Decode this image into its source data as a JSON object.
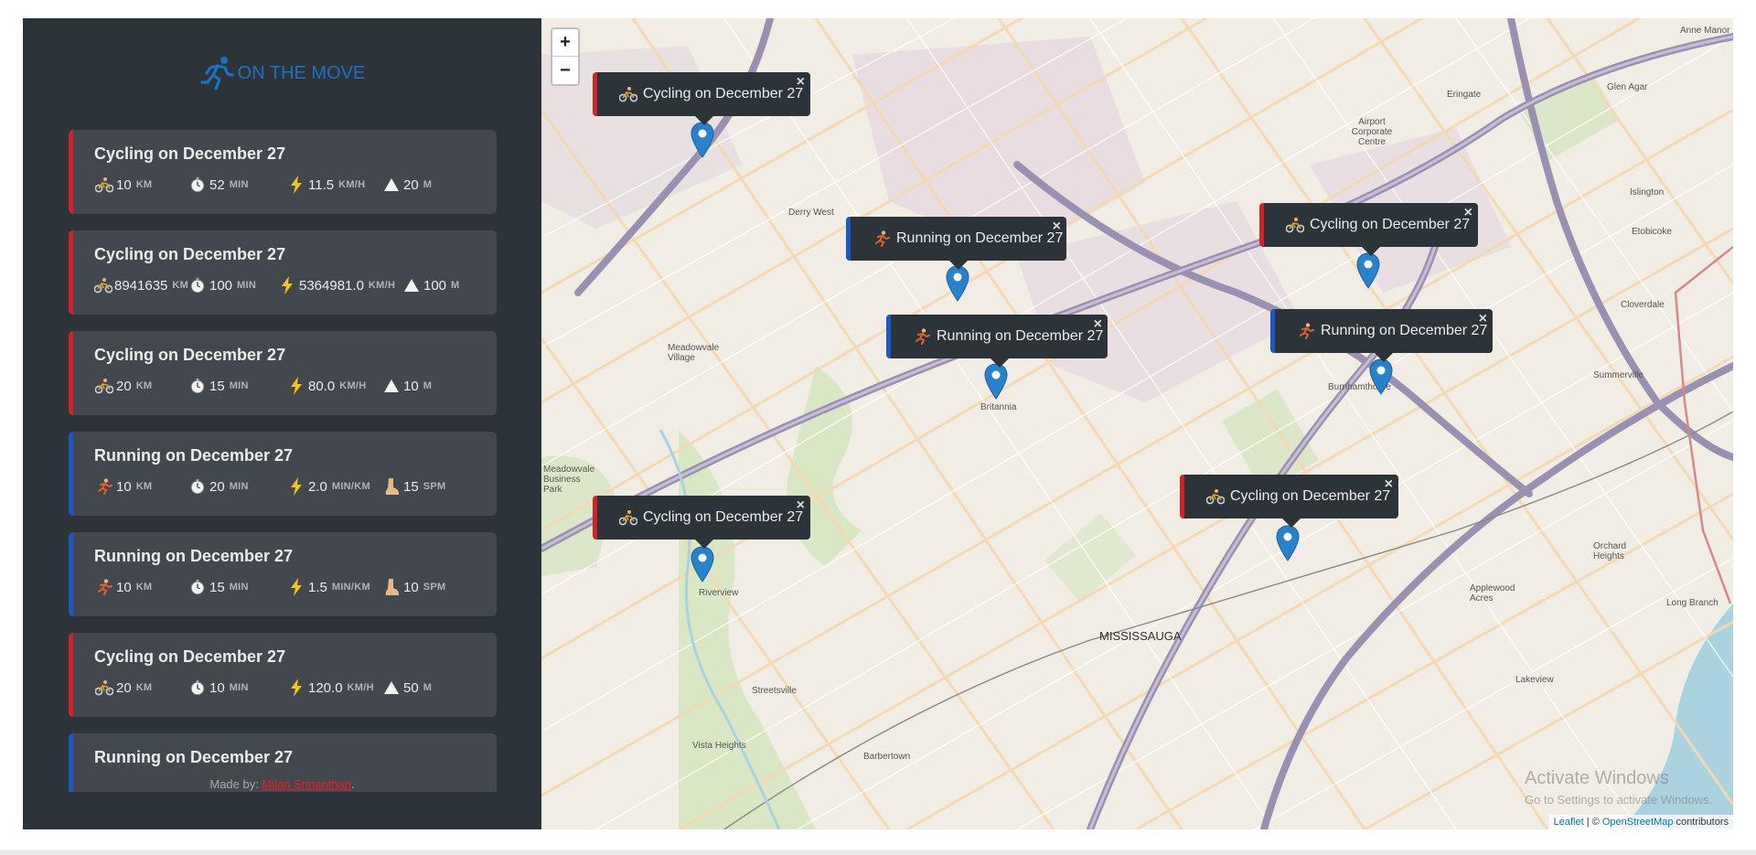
{
  "logo": {
    "text": "ON THE MOVE",
    "icon": "runner-icon",
    "color": "#1e6fc1"
  },
  "workouts": [
    {
      "type": "cycling",
      "title": "Cycling on December 27",
      "distance": "10",
      "duration": "52",
      "speed": "11.5",
      "speed_unit": "km/h",
      "extra": "20",
      "extra_unit": "m",
      "extra_icon": "elevation-icon"
    },
    {
      "type": "cycling",
      "title": "Cycling on December 27",
      "distance": "8941635",
      "duration": "100",
      "speed": "5364981.0",
      "speed_unit": "km/h",
      "extra": "100",
      "extra_unit": "m",
      "extra_icon": "elevation-icon"
    },
    {
      "type": "cycling",
      "title": "Cycling on December 27",
      "distance": "20",
      "duration": "15",
      "speed": "80.0",
      "speed_unit": "km/h",
      "extra": "10",
      "extra_unit": "m",
      "extra_icon": "elevation-icon"
    },
    {
      "type": "running",
      "title": "Running on December 27",
      "distance": "10",
      "duration": "20",
      "speed": "2.0",
      "speed_unit": "min/km",
      "extra": "15",
      "extra_unit": "spm",
      "extra_icon": "foot-icon"
    },
    {
      "type": "running",
      "title": "Running on December 27",
      "distance": "10",
      "duration": "15",
      "speed": "1.5",
      "speed_unit": "min/km",
      "extra": "10",
      "extra_unit": "spm",
      "extra_icon": "foot-icon"
    },
    {
      "type": "cycling",
      "title": "Cycling on December 27",
      "distance": "20",
      "duration": "10",
      "speed": "120.0",
      "speed_unit": "km/h",
      "extra": "50",
      "extra_unit": "m",
      "extra_icon": "elevation-icon"
    },
    {
      "type": "running",
      "title": "Running on December 27",
      "distance": "",
      "duration": "",
      "speed": "",
      "speed_unit": "",
      "extra": "",
      "extra_unit": "",
      "extra_icon": "foot-icon"
    }
  ],
  "units": {
    "distance": "km",
    "duration": "min"
  },
  "footer": {
    "prefix": "Made by: ",
    "author": "Milan Srinanthan",
    "suffix": "."
  },
  "map": {
    "zoom_in": "+",
    "zoom_out": "−",
    "popups": [
      {
        "type": "cycling",
        "text": "Cycling on December 27"
      },
      {
        "type": "running",
        "text": "Running on December 27"
      },
      {
        "type": "cycling",
        "text": "Cycling on December 27"
      },
      {
        "type": "running",
        "text": "Running on December 27"
      },
      {
        "type": "running",
        "text": "Running on December 27"
      },
      {
        "type": "cycling",
        "text": "Cycling on December 27"
      },
      {
        "type": "cycling",
        "text": "Cycling on December 27"
      }
    ],
    "close_glyph": "×",
    "labels": [
      "MISSISSAUGA",
      "Britannia",
      "Riverview",
      "Meadowvale Village",
      "Derry West",
      "Streetsville",
      "Vista Heights",
      "Barbertown",
      "Burnhamthorpe",
      "Summerville",
      "Islington",
      "Eringate",
      "Glen Agar",
      "Cloverdale",
      "Applewood Acres",
      "Lakeview",
      "Orchard Heights",
      "Long Branch",
      "Airport Corporate Centre",
      "Anne Manor",
      "Etobicoke",
      "Meadowvale Business Park"
    ],
    "attribution": {
      "leaflet": "Leaflet",
      "sep": " | © ",
      "osm": "OpenStreetMap",
      "suffix": " contributors"
    },
    "watermark": {
      "title": "Activate Windows",
      "subtitle": "Go to Settings to activate Windows."
    }
  },
  "colors": {
    "cycling": "#d1222b",
    "running": "#1b58c2",
    "sidebar": "#2d3439",
    "card": "#42484d"
  }
}
